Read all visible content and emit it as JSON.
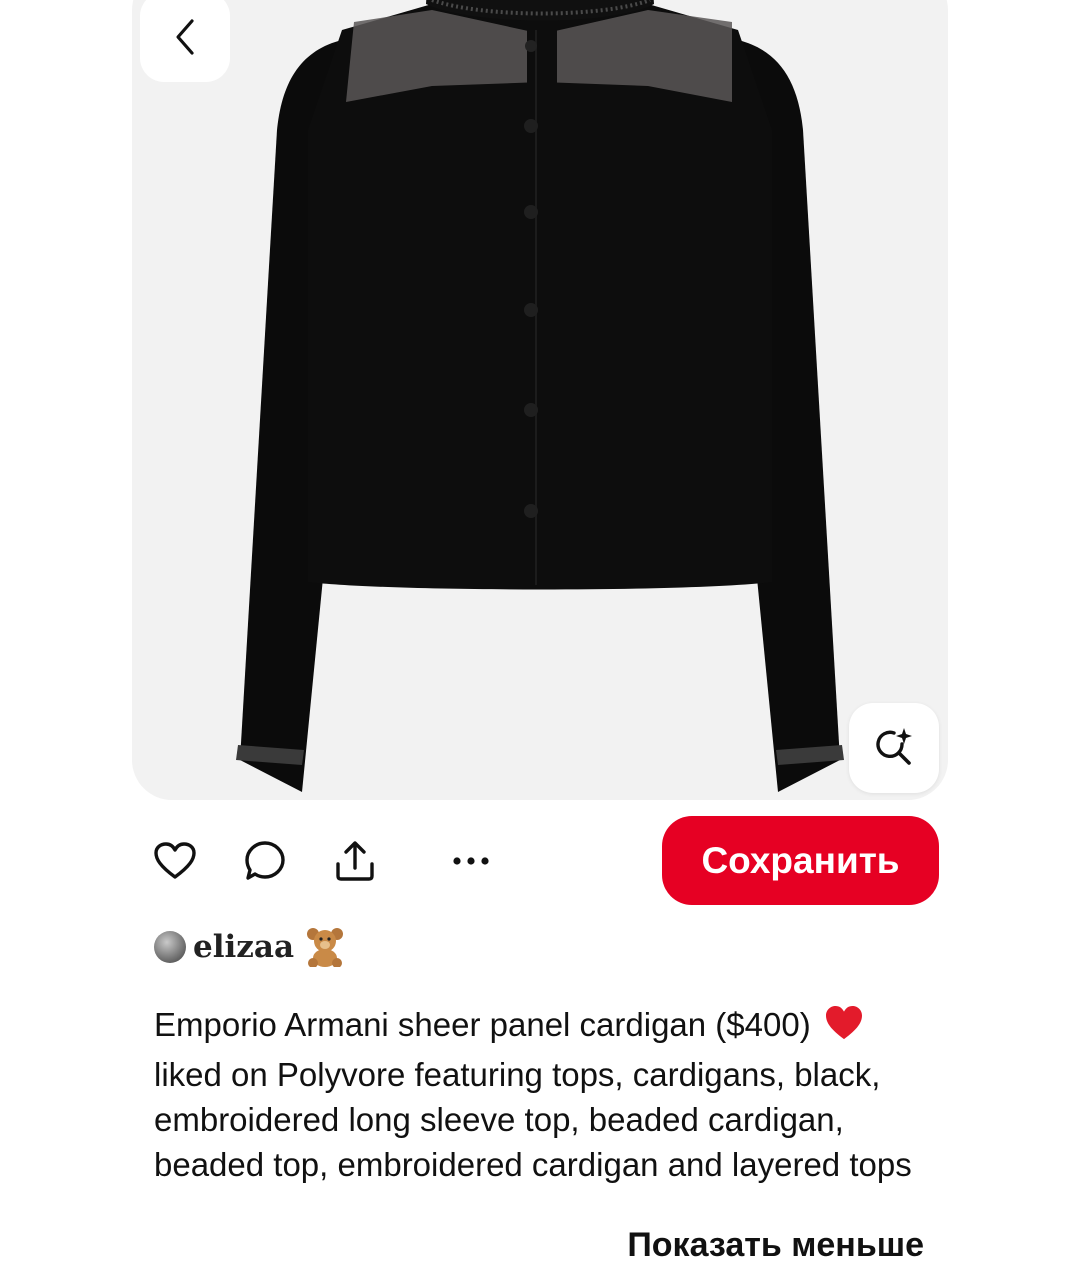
{
  "pin": {
    "image_alt": "Black cardigan with sheer shoulder panel",
    "back_icon": "chevron-left-icon",
    "visual_search_icon": "magnifier-sparkle-icon"
  },
  "actions": {
    "like_icon": "heart-icon",
    "comment_icon": "comment-icon",
    "share_icon": "share-icon",
    "more_icon": "more-icon",
    "save_label": "Сохранить"
  },
  "author": {
    "name": "elizaa",
    "emoji_icon": "teddy-bear-icon"
  },
  "description": {
    "part1": "Emporio Armani sheer panel cardigan ($400)",
    "heart_icon": "red-heart-icon",
    "part2": "liked on Polyvore featuring tops, cardigans, black, embroidered long sleeve top, beaded cardigan, beaded top, embroidered cardigan and layered tops"
  },
  "show_less_label": "Показать меньше",
  "colors": {
    "accent": "#e60023",
    "card_bg": "#f2f2f2",
    "text": "#111111"
  }
}
